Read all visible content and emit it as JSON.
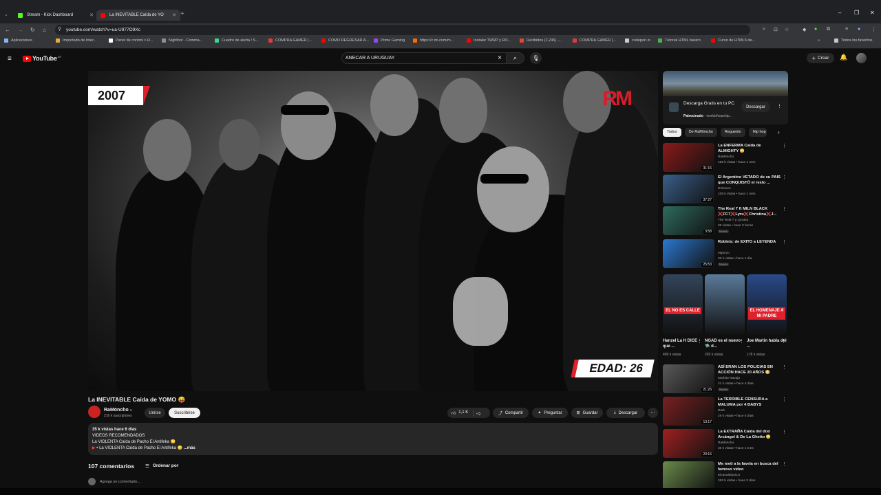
{
  "browser": {
    "tabs": [
      {
        "label": "Stream - Kick Dashboard",
        "active": false,
        "favicon_color": "#53fc18"
      },
      {
        "label": "La INEVITABLE Caída de YO",
        "active": true,
        "favicon_color": "#ff0000"
      }
    ],
    "new_tab": "+",
    "url": "youtube.com/watch?v=ua-U977O9Xc",
    "bookmarks": [
      {
        "label": "Aplicaciones",
        "color": "#8ab4f8"
      },
      {
        "label": "Importado de Inter...",
        "color": "#e8ab3a"
      },
      {
        "label": "Panel de control > R...",
        "color": "#ffffff"
      },
      {
        "label": "Nightbot - Comma...",
        "color": "#8e8e8e"
      },
      {
        "label": "Cuadro de alerta / S...",
        "color": "#3dd68c"
      },
      {
        "label": "COMPRA GAMER |...",
        "color": "#e53935"
      },
      {
        "label": "COMO REGRESAR A...",
        "color": "#ff0000"
      },
      {
        "label": "Prime Gaming",
        "color": "#9146ff"
      },
      {
        "label": "https://c.mi.com/m...",
        "color": "#ff6900"
      },
      {
        "label": "Instalar TWRP y RO...",
        "color": "#ff0000"
      },
      {
        "label": "Recibidos (2,245) -...",
        "color": "#ea4335"
      },
      {
        "label": "COMPRA GAMER |...",
        "color": "#e53935"
      },
      {
        "label": "codepen.io",
        "color": "#cccccc"
      },
      {
        "label": "Tutorial HTML basico",
        "color": "#4caf50"
      },
      {
        "label": "Curso de HTML5 de...",
        "color": "#ff0000"
      }
    ],
    "all_favorites": "Todos los favoritos"
  },
  "youtube": {
    "logo_text": "YouTube",
    "logo_country": "AR",
    "search_value": "ANECAR A URUGUAY",
    "create_label": "Crear"
  },
  "video": {
    "overlay_year": "2007",
    "overlay_age": "EDAD: 26",
    "overlay_logo": "RM",
    "title": "La INEVITABLE Caída de YOMO 😝",
    "channel": "RaMöncho",
    "subscribers": "216 k suscriptores",
    "join_label": "Unirse",
    "subscribe_label": "Suscribirse",
    "likes": "1,1 K",
    "share_label": "Compartir",
    "ask_label": "Preguntar",
    "save_label": "Guardar",
    "download_label": "Descargar",
    "description": {
      "meta": "35 k vistas  hace 6 días",
      "line1": "VIDEOS RECOMENDADOS",
      "line2": "La VIOLENTA Caída de Pacho El Antifeka 😳",
      "line3": "• La VIOLENTA Caída de Pacho El Antifeka 😳",
      "more": "...más"
    }
  },
  "comments": {
    "count_label": "107 comentarios",
    "sort_label": "Ordenar por",
    "add_placeholder": "Agrega un comentario..."
  },
  "sidebar": {
    "ad": {
      "title": "Descarga Gratis en tu PC",
      "sponsored": "Patrocinado",
      "advertiser": "worldofwarship...",
      "cta": "Descargar"
    },
    "chips": [
      "Todos",
      "De RaMöncho",
      "Reguetón",
      "Hip hop"
    ],
    "related": [
      {
        "title": "La ENFERMA Caída de ALMIGHTY 😳",
        "channel": "RaMöncho",
        "views": "169 k vistas • hace 1 mes",
        "duration": "31:16",
        "new": "",
        "thumb": "#8b1a1a"
      },
      {
        "title": "El Argentino VETADO de su PAIS que CONQUISTÓ el resto ...",
        "channel": "DrSeven",
        "views": "105 k vistas • hace 1 mes",
        "duration": "37:27",
        "new": "",
        "thumb": "#3a5f8a"
      },
      {
        "title": "The Real 7 ft MILN BLACK ❌FC7❌Lyru❌Christina❌J...",
        "channel": "The Real 7 y Lyrat63",
        "views": "36 vistas • hace 3 horas",
        "duration": "3:58",
        "new": "Nuevo",
        "thumb": "#2e6b5e"
      },
      {
        "title": "Robleis: de EXITO a LEYENDA",
        "channel": "elgonzo",
        "views": "20 k vistas • hace 1 día",
        "duration": "25:53",
        "new": "Nuevo",
        "thumb": "#2b78d0"
      },
      {
        "title": "ASÍ ERAN LOS POLICIAS EN ACCIÓN HACE 20 AÑOS 😳",
        "channel": "Markito Navaja",
        "views": "21 k vistas • hace 4 días",
        "duration": "21:26",
        "new": "Nuevo",
        "thumb": "#5a5a5a"
      },
      {
        "title": "La TERRIBLE CENSURA a MALUMA por 4 BABYS",
        "channel": "Dark",
        "views": "29 k vistas • hace 6 días",
        "duration": "13:17",
        "new": "",
        "thumb": "#7a2020"
      },
      {
        "title": "La EXTRAÑA Caída del dúo Arcángel & De La Ghetto 😳",
        "channel": "RaMöncho",
        "views": "36 k vistas • hace 1 mes",
        "duration": "20:16",
        "new": "",
        "thumb": "#a02020"
      },
      {
        "title": "Me metí a la favela en busca del famoso video",
        "channel": "Elcanaldejosco",
        "views": "262 k vistas • hace 3 días",
        "duration": "",
        "new": "",
        "thumb": "#6a8a4a"
      }
    ],
    "shorts": [
      {
        "title": "Hanzel La H DICE que ...",
        "views": "499 k vistas",
        "banner": "EL NO ES CALLE",
        "thumb": "#33445a"
      },
      {
        "title": "NGAD es el nuevo 🛸 d...",
        "views": "203 k vistas",
        "banner": "",
        "thumb": "#5a7a99"
      },
      {
        "title": "Joe Martin habla del ...",
        "views": "178 k vistas",
        "banner": "EL HOMENAJE A MI PADRE",
        "thumb": "#2a4a8a"
      }
    ]
  }
}
